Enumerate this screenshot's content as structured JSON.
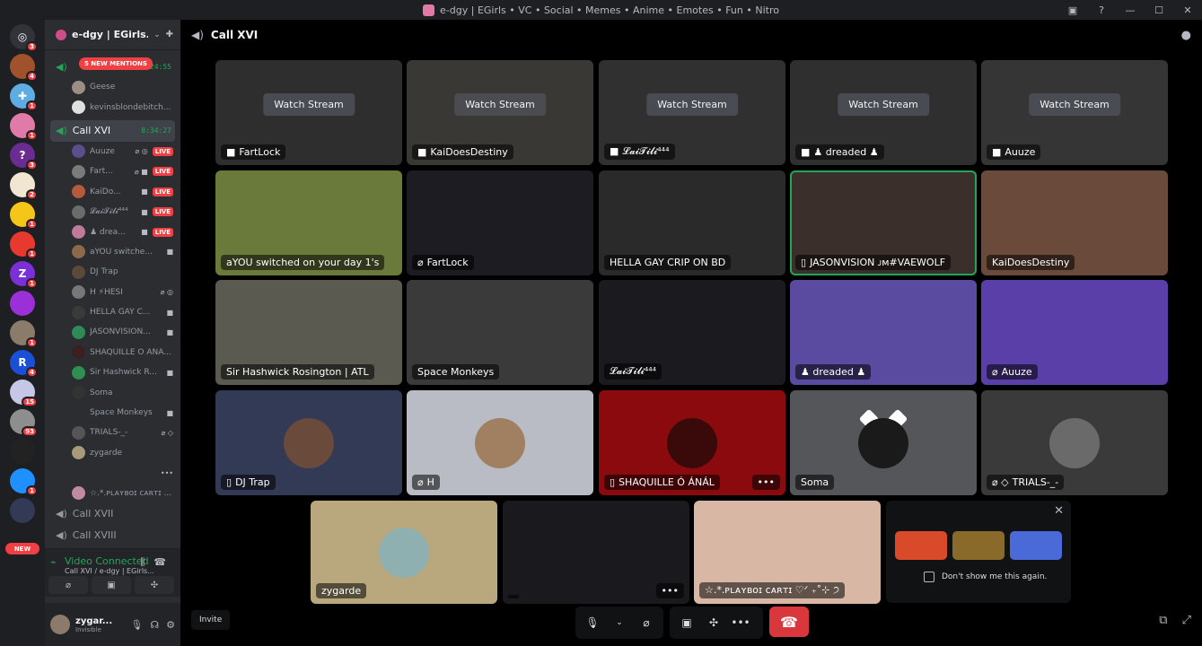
{
  "window": {
    "title": "e-dgy | EGirls • VC • Social • Memes • Anime • Emotes • Fun • Nitro",
    "controls": [
      "inbox-icon",
      "help-icon",
      "minimize-icon",
      "maximize-icon",
      "close-icon"
    ]
  },
  "guilds": [
    {
      "name": "discord-home-icon",
      "color": "#313338",
      "glyph": "◎",
      "badge": "3"
    },
    {
      "name": "server-1",
      "color": "#a0522d",
      "glyph": "",
      "badge": "4"
    },
    {
      "name": "server-2",
      "color": "#5dade2",
      "glyph": "✚",
      "badge": "1"
    },
    {
      "name": "server-3",
      "color": "#e07aa8",
      "glyph": "",
      "badge": "1"
    },
    {
      "name": "server-4",
      "color": "#6a2c91",
      "glyph": "?",
      "badge": "3"
    },
    {
      "name": "server-5",
      "color": "#f0e6d2",
      "glyph": "",
      "badge": "2"
    },
    {
      "name": "server-6",
      "color": "#f5c518",
      "glyph": "",
      "badge": "1"
    },
    {
      "name": "server-7",
      "color": "#e8392e",
      "glyph": "",
      "badge": "1"
    },
    {
      "name": "server-8",
      "color": "#7b2fd6",
      "glyph": "Z",
      "badge": "1"
    },
    {
      "name": "server-9",
      "color": "#9b30d9",
      "glyph": "",
      "badge": ""
    },
    {
      "name": "server-10",
      "color": "#8a7b6a",
      "glyph": "",
      "badge": "1"
    },
    {
      "name": "server-11",
      "color": "#1a4fd6",
      "glyph": "R",
      "badge": "4"
    },
    {
      "name": "server-12",
      "color": "#c6c6e6",
      "glyph": "",
      "badge": "15"
    },
    {
      "name": "server-13",
      "color": "#8e8e8e",
      "glyph": "",
      "badge": "93"
    },
    {
      "name": "server-14",
      "color": "#222222",
      "glyph": "",
      "badge": ""
    },
    {
      "name": "server-15",
      "color": "#1e90ff",
      "glyph": "",
      "badge": "1"
    },
    {
      "name": "server-16",
      "color": "#333a55",
      "glyph": "",
      "badge": ""
    }
  ],
  "new_pill": "NEW",
  "server": {
    "name": "e-dgy | EGirls..."
  },
  "mentions_label": "5 NEW MENTIONS",
  "channels": {
    "first_channel": {
      "time": "24:55"
    },
    "first_users": [
      {
        "name": "Geese",
        "color": "#9b8f85"
      },
      {
        "name": "kevinsblondebitch...",
        "color": "#e0e0e0"
      }
    ],
    "active": {
      "name": "Call XVI",
      "time": "8:34:27"
    },
    "active_users": [
      {
        "name": "Auuze",
        "color": "#5d4d8a",
        "icons": "⌀ ◎",
        "live": "LIVE"
      },
      {
        "name": "Fart...",
        "color": "#7a7a7a",
        "icons": "⌀ ■",
        "live": "LIVE"
      },
      {
        "name": "KaiDo...",
        "color": "#b55a3c",
        "icons": "■",
        "live": "LIVE"
      },
      {
        "name": "𝓛𝓪𝓲𝓣𝓲𝓵𝓲⁴⁴⁴",
        "color": "#6b6b6b",
        "icons": "■",
        "live": "LIVE"
      },
      {
        "name": "♟ drea...",
        "color": "#c07a9a",
        "icons": "■",
        "live": "LIVE"
      },
      {
        "name": "aYOU switche...",
        "color": "#8a6a4a",
        "icons": "■",
        "live": ""
      },
      {
        "name": "DJ Trap",
        "color": "#5a4a3a",
        "icons": "",
        "live": ""
      },
      {
        "name": "H  ⚡HESI",
        "color": "#777777",
        "icons": "⌀ ◎",
        "live": ""
      },
      {
        "name": "HELLA GAY C...",
        "color": "#3a3a3a",
        "icons": "■",
        "live": ""
      },
      {
        "name": "JASONVISION...",
        "color": "#2e8b57",
        "icons": "■",
        "live": ""
      },
      {
        "name": "SHAQUILLE Ó ÁNÁ...",
        "color": "#3a2020",
        "icons": "",
        "live": ""
      },
      {
        "name": "Sir Hashwick R...",
        "color": "#2f8f4f",
        "icons": "■",
        "live": ""
      },
      {
        "name": "Soma",
        "color": "#333333",
        "icons": "",
        "live": ""
      },
      {
        "name": "Space Monkeys",
        "color": "#2b2d31",
        "icons": "■",
        "live": ""
      },
      {
        "name": "TRIALS-_-",
        "color": "#555555",
        "icons": "⌀ ◇",
        "live": ""
      },
      {
        "name": "zygarde",
        "color": "#a89a7a",
        "icons": "",
        "live": ""
      },
      {
        "name": "",
        "color": "#2b2d31",
        "icons": "•••",
        "live": ""
      },
      {
        "name": "☆.*.ᴘʟᴀʏʙᴏɪ ᴄᴀʀᴛɪ ...",
        "color": "#c08aa0",
        "icons": "",
        "live": ""
      }
    ],
    "next": [
      {
        "name": "Call XVII"
      },
      {
        "name": "Call XVIII"
      }
    ]
  },
  "voice_panel": {
    "status": "Video Connected",
    "sub": "Call XVI / e-dgy | EGirls..."
  },
  "user_panel": {
    "name": "zygar...",
    "status": "Invisible"
  },
  "call": {
    "title": "Call XVI"
  },
  "tiles": [
    {
      "name": "FartLock",
      "icon": "■",
      "bg": "#2e2e2e",
      "watch": "Watch Stream"
    },
    {
      "name": "KaiDoesDestiny",
      "icon": "■",
      "bg": "#3a3834",
      "watch": "Watch Stream"
    },
    {
      "name": "𝓛𝓪𝓲𝓣𝓲𝓵𝓲⁴⁴⁴",
      "icon": "■",
      "bg": "#303030",
      "watch": "Watch Stream"
    },
    {
      "name": "♟ dreaded ♟",
      "icon": "■",
      "bg": "#2f2f2f",
      "watch": "Watch Stream"
    },
    {
      "name": "Auuze",
      "icon": "■",
      "bg": "#353535",
      "watch": "Watch Stream"
    },
    {
      "name": "aYOU switched on your day 1's",
      "icon": "",
      "bg": "#6a7a3a",
      "watch": ""
    },
    {
      "name": "FartLock",
      "icon": "⌀",
      "bg": "#1c1c22",
      "watch": ""
    },
    {
      "name": "HELLA GAY CRIP ON BD",
      "icon": "",
      "bg": "#2a2a2a",
      "watch": ""
    },
    {
      "name": "JASONVISION ᴊᴍ#VAEWOLF",
      "icon": "▯",
      "bg": "#3a2f2a",
      "watch": ""
    },
    {
      "name": "KaiDoesDestiny",
      "icon": "",
      "bg": "#6a4a3a",
      "watch": ""
    },
    {
      "name": "Sir Hashwick Rosington | ATL",
      "icon": "",
      "bg": "#5a5a50",
      "watch": ""
    },
    {
      "name": "Space Monkeys",
      "icon": "",
      "bg": "#3a3a3a",
      "watch": ""
    },
    {
      "name": "𝓛𝓪𝓲𝓣𝓲𝓵𝓲⁴⁴⁴",
      "icon": "",
      "bg": "#1a1a1f",
      "watch": ""
    },
    {
      "name": "♟ dreaded ♟",
      "icon": "",
      "bg": "#5a4aa0",
      "watch": ""
    },
    {
      "name": "Auuze",
      "icon": "⌀",
      "bg": "#5a3fa8",
      "watch": ""
    },
    {
      "name": "DJ Trap",
      "icon": "▯",
      "bg": "#333a55",
      "watch": ""
    },
    {
      "name": "H",
      "icon": "⌀",
      "bg": "#b9bcc4",
      "watch": ""
    },
    {
      "name": "SHAQUILLE Ó ÁNÁL",
      "icon": "▯",
      "bg": "#8b0a0e",
      "watch": ""
    },
    {
      "name": "Soma",
      "icon": "",
      "bg": "#55565a",
      "watch": ""
    },
    {
      "name": "TRIALS-_-",
      "icon": "⌀ ◇",
      "bg": "#3a3a3a",
      "watch": ""
    },
    {
      "name": "zygarde",
      "icon": "",
      "bg": "#b9a87e",
      "watch": ""
    },
    {
      "name": "",
      "icon": "",
      "bg": "#1a1a1e",
      "watch": ""
    },
    {
      "name": "☆.*.ᴘʟᴀʏʙᴏɪ ᴄᴀʀᴛɪ ♡ᐟ ₊˚⊹ ੭",
      "icon": "",
      "bg": "#d8b7a5",
      "watch": ""
    }
  ],
  "promo": {
    "dont_show": "Don't show me this again."
  },
  "controls": {
    "invite": "Invite"
  }
}
